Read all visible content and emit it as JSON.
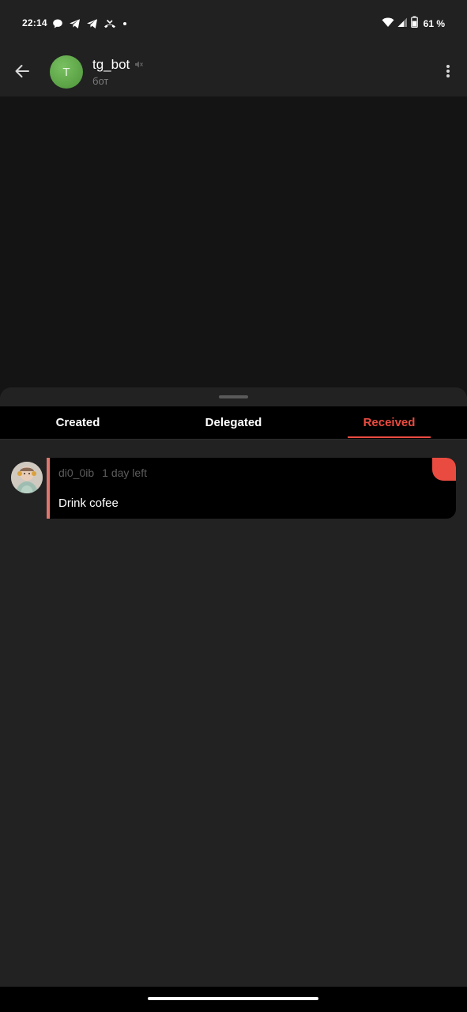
{
  "status_bar": {
    "time": "22:14",
    "battery_percent": "61 %",
    "left_icons": [
      "chat-bubble-icon",
      "telegram-icon",
      "telegram-icon",
      "missed-call-icon",
      "dot-icon"
    ],
    "right_icons": [
      "wifi-icon",
      "signal-icon",
      "battery-icon"
    ]
  },
  "header": {
    "title": "tg_bot",
    "subtitle": "бот",
    "avatar_letter": "T",
    "avatar_color": "#5aa145",
    "muted": true
  },
  "sheet": {
    "tabs": [
      {
        "label": "Created",
        "active": false
      },
      {
        "label": "Delegated",
        "active": false
      },
      {
        "label": "Received",
        "active": true
      }
    ],
    "accent_color": "#ea4b40",
    "tasks": [
      {
        "author": "di0_0ib",
        "deadline": "1 day left",
        "title": "Drink cofee",
        "accent_color": "#e0766c"
      }
    ]
  }
}
